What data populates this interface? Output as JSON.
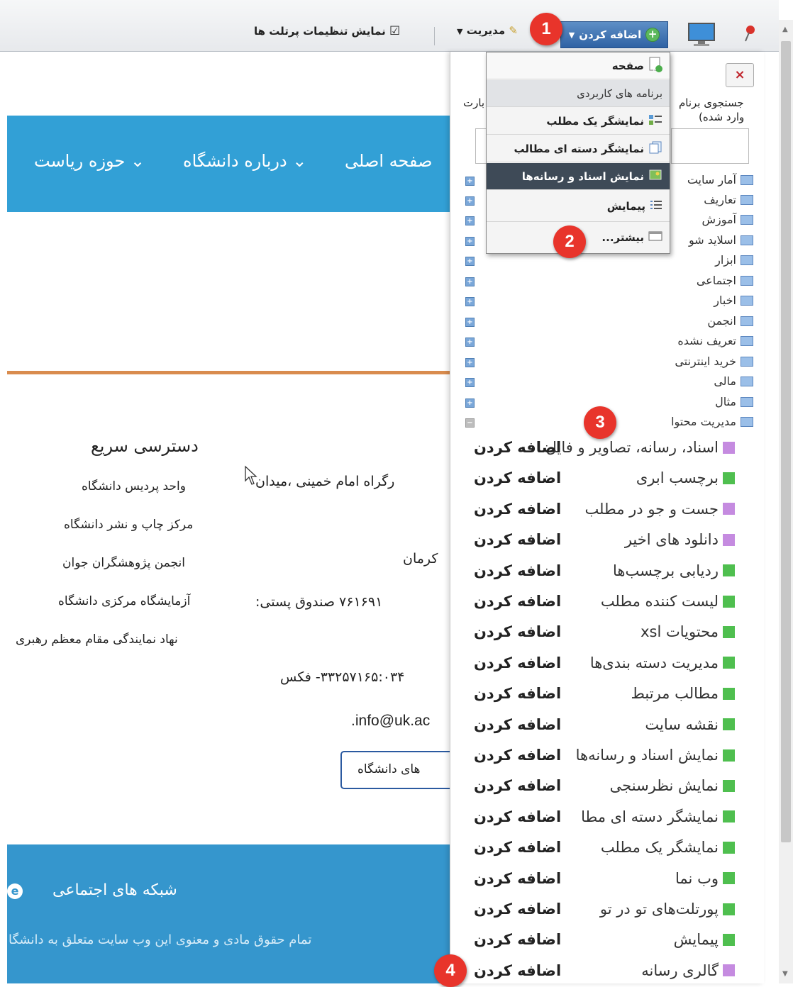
{
  "dockbar": {
    "add_label": "اضافه کردن",
    "manage_label": "مدیریت",
    "portlet_settings_label": "نمایش تنظیمات پرتلت ها"
  },
  "dropdown": {
    "page_label": "صفحه",
    "apps_header": "برنامه های کاربردی",
    "items": [
      "نمایشگر یک مطلب",
      "نمایشگر دسته ای مطالب",
      "نمایش اسناد و رسانه‌ها",
      "پیمایش",
      "بیشتر..."
    ]
  },
  "panel": {
    "close_label": "×",
    "search_label_1": "جستجوی برنام",
    "search_label_1b": "بارت",
    "search_label_2": "وارد شده)",
    "categories": [
      "آمار سایت",
      "تعاریف",
      "آموزش",
      "اسلاید شو",
      "ابزار",
      "اجتماعی",
      "اخبار",
      "انجمن",
      "تعریف نشده",
      "خرید اینترنتی",
      "مالی",
      "مثال",
      "مدیریت محتوا"
    ],
    "add_text": "اضافه کردن",
    "apps": [
      {
        "name": "اسناد، رسانه، تصاویر و فایل",
        "color": "#c58be0"
      },
      {
        "name": "برچسب ابری",
        "color": "#4fbf4f"
      },
      {
        "name": "جست و جو در مطلب",
        "color": "#c58be0"
      },
      {
        "name": "دانلود های اخیر",
        "color": "#c58be0"
      },
      {
        "name": "ردیابی برچسب‌ها",
        "color": "#4fbf4f"
      },
      {
        "name": "لیست کننده مطلب",
        "color": "#4fbf4f"
      },
      {
        "name": "محتویات xsl",
        "color": "#4fbf4f"
      },
      {
        "name": "مدیریت دسته بندی‌ها",
        "color": "#4fbf4f"
      },
      {
        "name": "مطالب مرتبط",
        "color": "#4fbf4f"
      },
      {
        "name": "نقشه سایت",
        "color": "#4fbf4f"
      },
      {
        "name": "نمایش اسناد و رسانه‌ها",
        "color": "#4fbf4f"
      },
      {
        "name": "نمایش نظرسنجی",
        "color": "#4fbf4f"
      },
      {
        "name": "نمایشگر دسته ای مطا",
        "color": "#4fbf4f"
      },
      {
        "name": "نمایشگر یک مطلب",
        "color": "#4fbf4f"
      },
      {
        "name": "وب نما",
        "color": "#4fbf4f"
      },
      {
        "name": "پورتلت‌های تو در تو",
        "color": "#4fbf4f"
      },
      {
        "name": "پیمایش",
        "color": "#4fbf4f"
      },
      {
        "name": "گالری رسانه",
        "color": "#c58be0"
      }
    ]
  },
  "nav": {
    "home": "صفحه اصلی",
    "about": "درباره دانشگاه",
    "presidency": "حوزه ریاست"
  },
  "quick_access": {
    "title": "دسترسی سریع",
    "links": [
      "واحد پردیس دانشگاه",
      "مرکز چاپ و نشر دانشگاه",
      "انجمن پژوهشگران جوان",
      "آزمایشگاه مرکزی دانشگاه",
      "نهاد نمایندگی مقام معظم رهبری"
    ]
  },
  "contact": {
    "address": "رگراه امام خمینی ،میدان",
    "city": "کرمان",
    "postal": "۷۶۱۶۹۱   صندوق   پستی:",
    "fax": "۳۳۲۵۷۱۶۵:۰۳۴-  فکس",
    "email": "info@uk.ac.",
    "links_button": "های دانشگاه"
  },
  "footer": {
    "social": "شبکه های اجتماعی",
    "copyright": "تمام حقوق مادی و معنوی این وب سایت متعلق به دانشگا"
  },
  "callouts": [
    "1",
    "2",
    "3",
    "4"
  ]
}
